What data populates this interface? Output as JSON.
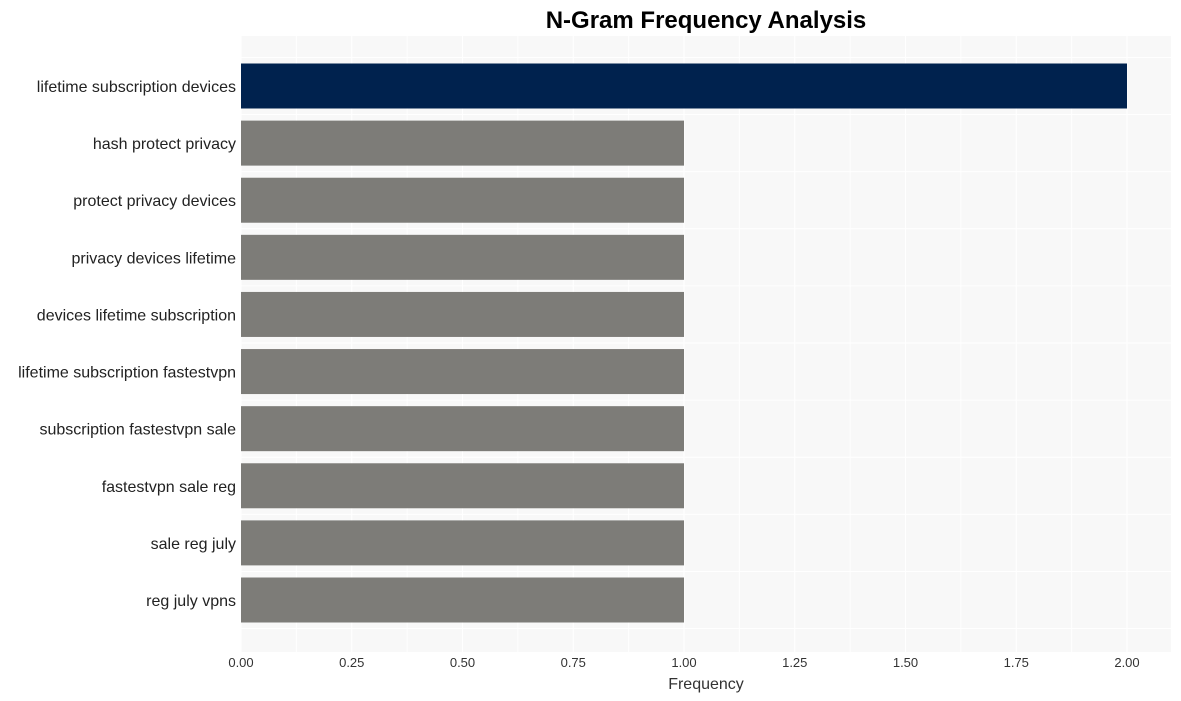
{
  "chart_data": {
    "type": "bar",
    "orientation": "horizontal",
    "title": "N-Gram Frequency Analysis",
    "xlabel": "Frequency",
    "ylabel": "",
    "xlim": [
      0,
      2.1
    ],
    "x_ticks": [
      "0.00",
      "0.25",
      "0.50",
      "0.75",
      "1.00",
      "1.25",
      "1.50",
      "1.75",
      "2.00"
    ],
    "x_tick_values": [
      0,
      0.25,
      0.5,
      0.75,
      1.0,
      1.25,
      1.5,
      1.75,
      2.0
    ],
    "grid": true,
    "categories": [
      "lifetime subscription devices",
      "hash protect privacy",
      "protect privacy devices",
      "privacy devices lifetime",
      "devices lifetime subscription",
      "lifetime subscription fastestvpn",
      "subscription fastestvpn sale",
      "fastestvpn sale reg",
      "sale reg july",
      "reg july vpns"
    ],
    "values": [
      2,
      1,
      1,
      1,
      1,
      1,
      1,
      1,
      1,
      1
    ],
    "colors": {
      "highlight": "#00224e",
      "default": "#7d7c78",
      "plot_background": "#f8f8f8",
      "grid": "#ffffff"
    }
  }
}
